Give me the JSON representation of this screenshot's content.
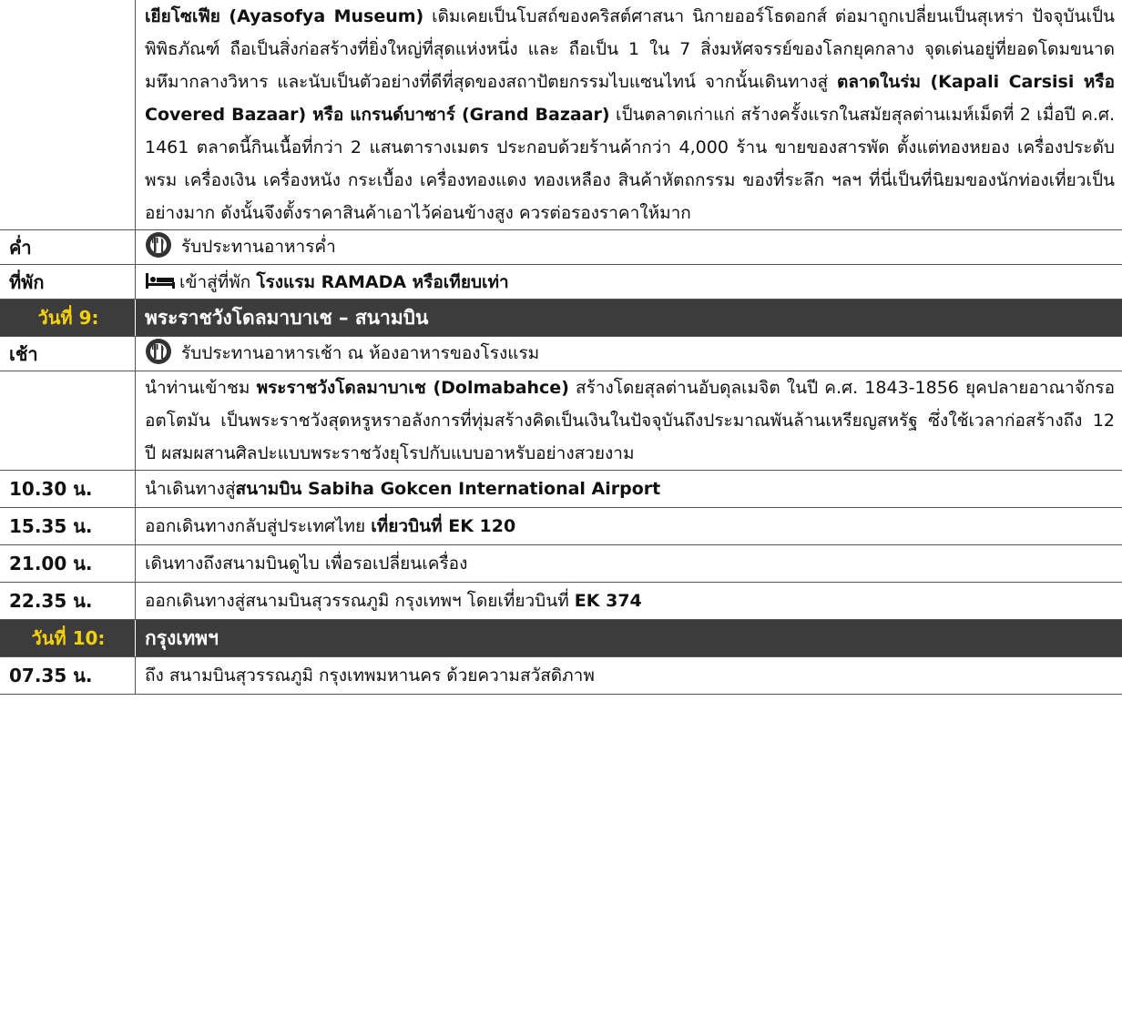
{
  "top": {
    "p1": "เยียโซเฟีย (Ayasofya Museum)",
    "p2": " เดิมเคยเป็นโบสถ์ของคริสต์ศาสนา นิกายออร์โธดอกส์ ต่อมาถูกเปลี่ยนเป็นสุเหร่า ปัจจุบันเป็นพิพิธภัณฑ์ ถือเป็นสิ่งก่อสร้างที่ยิ่งใหญ่ที่สุดแห่งหนึ่ง และ ถือเป็น 1 ใน 7 สิ่งมหัศจรรย์ของโลกยุคกลาง จุดเด่นอยู่ที่ยอดโดมขนาดมหึมากลางวิหาร และนับเป็นตัวอย่างที่ดีที่สุดของสถาปัตยกรรมไบแซนไทน์ จากนั้นเดินทางสู่ ",
    "p3": "ตลาดในร่ม (Kapali Carsisi หรือ Covered Bazaar) หรือ แกรนด์บาซาร์ (Grand Bazaar)",
    "p4": " เป็นตลาดเก่าแก่ สร้างครั้งแรกในสมัยสุลต่านเมห์เม็ดที่ 2 เมื่อปี ค.ศ. 1461 ตลาดนี้กินเนื้อที่กว่า 2 แสนตารางเมตร ประกอบด้วยร้านค้ากว่า 4,000 ร้าน ขายของสารพัด ตั้งแต่ทองหยอง เครื่องประดับ พรม เครื่องเงิน เครื่องหนัง กระเบื้อง เครื่องทองแดง ทองเหลือง สินค้าหัตถกรรม ของที่ระลึก ฯลฯ ที่นี่เป็นที่นิยมของนักท่องเที่ยวเป็นอย่างมาก ดังนั้นจึงตั้งราคาสินค้าเอาไว้ค่อนข้างสูง ควรต่อรองราคาให้มาก"
  },
  "dinner": {
    "time": "ค่ำ",
    "text": "รับประทานอาหารค่ำ",
    "icon": "restaurant-icon"
  },
  "hotel": {
    "time": "ที่พัก",
    "text": "เข้าสู่ที่พัก ",
    "bold": "โรงแรม RAMADA หรือเทียบเท่า",
    "icon": "bed-icon"
  },
  "day9": {
    "label": "วันที่ 9:",
    "title": "พระราชวังโดลมาบาเช – สนามบิน"
  },
  "breakfast": {
    "time": "เช้า",
    "text": "รับประทานอาหารเช้า ณ ห้องอาหารของโรงแรม",
    "icon": "restaurant-icon"
  },
  "dolma": {
    "p1": "นำท่านเข้าชม ",
    "p2": "พระราชวังโดลมาบาเช (Dolmabahce)",
    "p3": " สร้างโดยสุลต่านอับดุลเมจิต ในปี ค.ศ. 1843-1856 ยุคปลายอาณาจักรออตโตมัน เป็นพระราชวังสุดหรูหราอลังการที่ทุ่มสร้างคิดเป็นเงินในปัจจุบันถึงประมาณพันล้านเหรียญสหรัฐ ซึ่งใช้เวลาก่อสร้างถึง 12 ปี ผสมผสานศิลปะแบบพระราชวังยุโรปกับแบบอาหรับอย่างสวยงาม"
  },
  "r1030": {
    "time": "10.30 น.",
    "text": "นำเดินทางสู่",
    "bold": "สนามบิน Sabiha Gokcen International Airport"
  },
  "r1535": {
    "time": "15.35 น.",
    "text": "ออกเดินทางกลับสู่ประเทศไทย ",
    "bold": "เที่ยวบินที่ EK 120"
  },
  "r2100": {
    "time": "21.00 น.",
    "text": "เดินทางถึงสนามบินดูไบ เพื่อรอเปลี่ยนเครื่อง"
  },
  "r2235": {
    "time": "22.35 น.",
    "text": "ออกเดินทางสู่สนามบินสุวรรณภูมิ กรุงเทพฯ โดยเที่ยวบินที่ ",
    "bold": "EK 374"
  },
  "day10": {
    "label": "วันที่ 10:",
    "title": "กรุงเทพฯ"
  },
  "r0735": {
    "time": "07.35 น.",
    "text": "ถึง สนามบินสุวรรณภูมิ กรุงเทพมหานคร ด้วยความสวัสดิภาพ"
  },
  "colors": {
    "dayBar": "#3c3c3c",
    "dayLabel": "#f5d10a"
  }
}
